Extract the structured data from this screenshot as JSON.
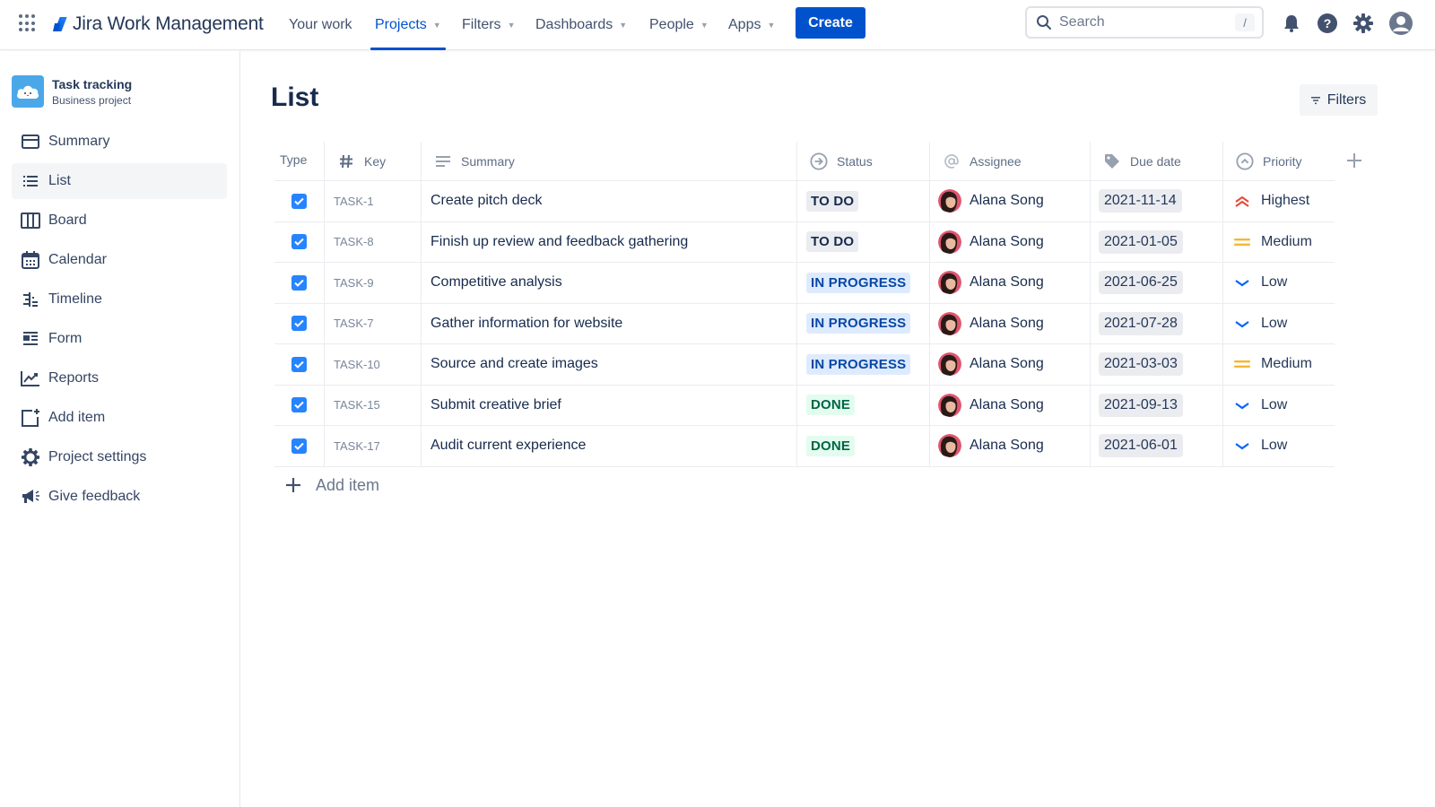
{
  "topnav": {
    "product_name": "Jira Work Management",
    "items": [
      {
        "label": "Your work",
        "has_dropdown": false,
        "active": false
      },
      {
        "label": "Projects",
        "has_dropdown": true,
        "active": true
      },
      {
        "label": "Filters",
        "has_dropdown": true,
        "active": false
      },
      {
        "label": "Dashboards",
        "has_dropdown": true,
        "active": false
      },
      {
        "label": "People",
        "has_dropdown": true,
        "active": false
      },
      {
        "label": "Apps",
        "has_dropdown": true,
        "active": false
      }
    ],
    "create_label": "Create",
    "search_placeholder": "Search",
    "search_shortcut": "/",
    "icons": [
      "notifications-icon",
      "help-icon",
      "settings-icon",
      "profile-icon"
    ],
    "accent_color": "#0052CC"
  },
  "sidebar": {
    "project_name": "Task tracking",
    "project_type": "Business project",
    "items": [
      {
        "label": "Summary",
        "icon": "summary-icon",
        "active": false
      },
      {
        "label": "List",
        "icon": "list-icon",
        "active": true
      },
      {
        "label": "Board",
        "icon": "board-icon",
        "active": false
      },
      {
        "label": "Calendar",
        "icon": "calendar-icon",
        "active": false
      },
      {
        "label": "Timeline",
        "icon": "timeline-icon",
        "active": false
      },
      {
        "label": "Form",
        "icon": "form-icon",
        "active": false
      },
      {
        "label": "Reports",
        "icon": "reports-icon",
        "active": false
      },
      {
        "label": "Add item",
        "icon": "add-item-icon",
        "active": false
      },
      {
        "label": "Project settings",
        "icon": "settings-icon",
        "active": false
      },
      {
        "label": "Give feedback",
        "icon": "megaphone-icon",
        "active": false
      }
    ]
  },
  "main": {
    "title": "List",
    "filters_label": "Filters",
    "columns": [
      {
        "label": "Type",
        "icon": null
      },
      {
        "label": "Key",
        "icon": "hash-icon"
      },
      {
        "label": "Summary",
        "icon": "text-lines-icon"
      },
      {
        "label": "Status",
        "icon": "status-arrow-icon"
      },
      {
        "label": "Assignee",
        "icon": "at-icon"
      },
      {
        "label": "Due date",
        "icon": "tag-icon"
      },
      {
        "label": "Priority",
        "icon": "priority-icon"
      }
    ],
    "rows": [
      {
        "checked": true,
        "key": "TASK-1",
        "summary": "Create pitch deck",
        "status": "TO DO",
        "status_type": "todo",
        "assignee": "Alana Song",
        "due_date": "2021-11-14",
        "priority": "Highest"
      },
      {
        "checked": true,
        "key": "TASK-8",
        "summary": "Finish up review and feedback gathering",
        "status": "TO DO",
        "status_type": "todo",
        "assignee": "Alana Song",
        "due_date": "2021-01-05",
        "priority": "Medium"
      },
      {
        "checked": true,
        "key": "TASK-9",
        "summary": "Competitive analysis",
        "status": "IN PROGRESS",
        "status_type": "progress",
        "assignee": "Alana Song",
        "due_date": "2021-06-25",
        "priority": "Low"
      },
      {
        "checked": true,
        "key": "TASK-7",
        "summary": "Gather information for website",
        "status": "IN PROGRESS",
        "status_type": "progress",
        "assignee": "Alana Song",
        "due_date": "2021-07-28",
        "priority": "Low"
      },
      {
        "checked": true,
        "key": "TASK-10",
        "summary": "Source and create images",
        "status": "IN PROGRESS",
        "status_type": "progress",
        "assignee": "Alana Song",
        "due_date": "2021-03-03",
        "priority": "Medium"
      },
      {
        "checked": true,
        "key": "TASK-15",
        "summary": "Submit creative brief",
        "status": "DONE",
        "status_type": "done",
        "assignee": "Alana Song",
        "due_date": "2021-09-13",
        "priority": "Low"
      },
      {
        "checked": true,
        "key": "TASK-17",
        "summary": "Audit current experience",
        "status": "DONE",
        "status_type": "done",
        "assignee": "Alana Song",
        "due_date": "2021-06-01",
        "priority": "Low"
      }
    ],
    "add_item_label": "Add item",
    "priority_colors": {
      "Highest": "#E5493A",
      "Medium": "#F5B730",
      "Low": "#0065FF"
    }
  }
}
